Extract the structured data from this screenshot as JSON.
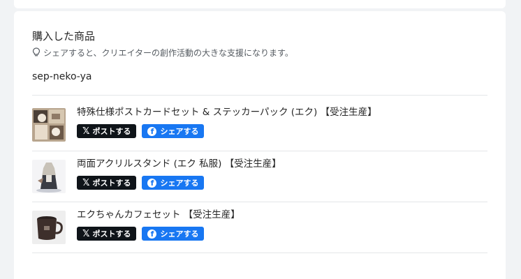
{
  "section": {
    "title": "購入した商品",
    "hint_icon": "lightbulb-icon",
    "hint": "シェアすると、クリエイターの創作活動の大きな支援になります。"
  },
  "shop": {
    "name": "sep-neko-ya"
  },
  "buttons": {
    "post_label": "ポストする",
    "share_label": "シェアする"
  },
  "items": [
    {
      "name": "特殊仕様ポストカードセット & ステッカーパック (エク) 【受注生産】"
    },
    {
      "name": "両面アクリルスタンド (エク 私服) 【受注生産】"
    },
    {
      "name": "エクちゃんカフェセット 【受注生産】"
    }
  ],
  "colors": {
    "x_button": "#0f1419",
    "facebook_button": "#1877f2",
    "divider": "#e4e6e8"
  }
}
